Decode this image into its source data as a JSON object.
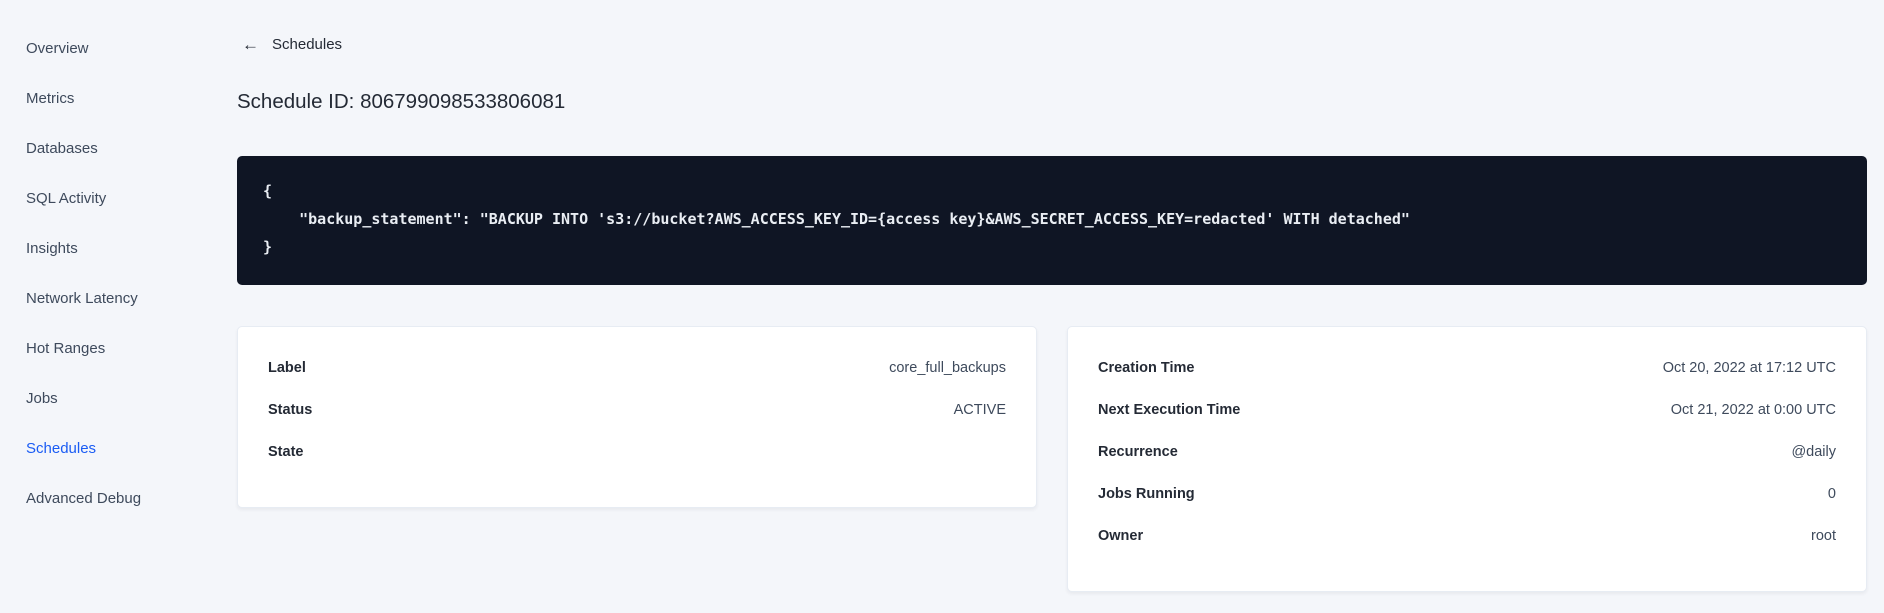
{
  "colors": {
    "page_bg": "#f4f6fa",
    "card_bg": "#ffffff",
    "card_border": "#e7ecf3",
    "code_bg": "#0f1524",
    "code_text": "#e9edf3",
    "text_primary": "#242a35",
    "text_secondary": "#3e4a5c",
    "accent_blue": "#1a5cf4"
  },
  "sidebar": {
    "items": [
      {
        "label": "Overview",
        "active": false
      },
      {
        "label": "Metrics",
        "active": false
      },
      {
        "label": "Databases",
        "active": false
      },
      {
        "label": "SQL Activity",
        "active": false
      },
      {
        "label": "Insights",
        "active": false
      },
      {
        "label": "Network Latency",
        "active": false
      },
      {
        "label": "Hot Ranges",
        "active": false
      },
      {
        "label": "Jobs",
        "active": false
      },
      {
        "label": "Schedules",
        "active": true
      },
      {
        "label": "Advanced Debug",
        "active": false
      }
    ]
  },
  "header": {
    "back_icon": "←",
    "back_label": "Schedules",
    "title": "Schedule ID: 806799098533806081"
  },
  "code_block": {
    "text": "{\n    \"backup_statement\": \"BACKUP INTO 's3://bucket?AWS_ACCESS_KEY_ID={access key}&AWS_SECRET_ACCESS_KEY=redacted' WITH detached\"\n}"
  },
  "details_left": {
    "rows": [
      {
        "label": "Label",
        "value": "core_full_backups"
      },
      {
        "label": "Status",
        "value": "ACTIVE"
      },
      {
        "label": "State",
        "value": ""
      }
    ]
  },
  "details_right": {
    "rows": [
      {
        "label": "Creation Time",
        "value": "Oct 20, 2022 at 17:12 UTC"
      },
      {
        "label": "Next Execution Time",
        "value": "Oct 21, 2022 at 0:00 UTC"
      },
      {
        "label": "Recurrence",
        "value": "@daily"
      },
      {
        "label": "Jobs Running",
        "value": "0"
      },
      {
        "label": "Owner",
        "value": "root"
      }
    ]
  }
}
